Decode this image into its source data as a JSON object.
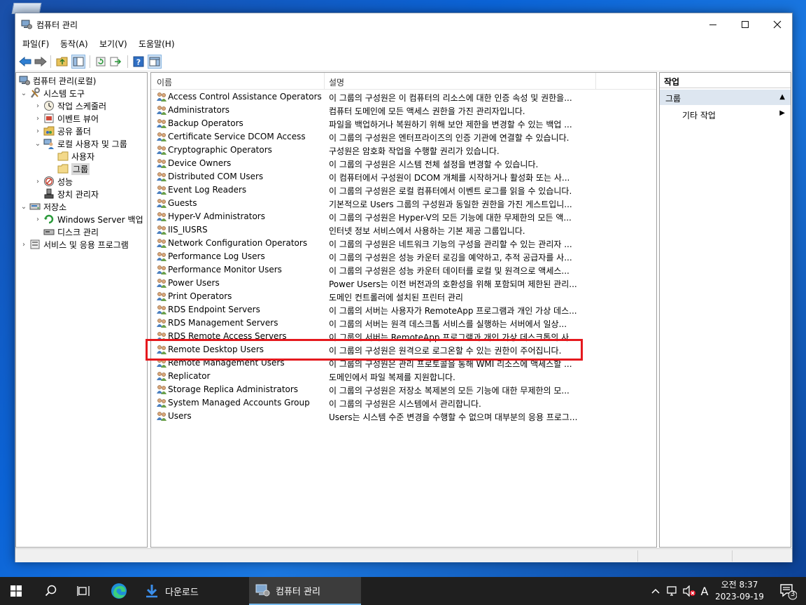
{
  "window": {
    "title": "컴퓨터 관리"
  },
  "menu": [
    "파일(F)",
    "동작(A)",
    "보기(V)",
    "도움말(H)"
  ],
  "tree": [
    {
      "label": "컴퓨터 관리(로컬)",
      "icon": "computer-management-icon"
    },
    {
      "label": "시스템 도구",
      "icon": "system-tools-icon"
    },
    {
      "label": "작업 스케줄러",
      "icon": "task-scheduler-icon"
    },
    {
      "label": "이벤트 뷰어",
      "icon": "event-viewer-icon"
    },
    {
      "label": "공유 폴더",
      "icon": "shared-folders-icon"
    },
    {
      "label": "로컬 사용자 및 그룹",
      "icon": "local-users-groups-icon"
    },
    {
      "label": "사용자",
      "icon": "folder-icon"
    },
    {
      "label": "그룹",
      "icon": "folder-icon"
    },
    {
      "label": "성능",
      "icon": "performance-icon"
    },
    {
      "label": "장치 관리자",
      "icon": "device-manager-icon"
    },
    {
      "label": "저장소",
      "icon": "storage-icon"
    },
    {
      "label": "Windows Server 백업",
      "icon": "backup-icon"
    },
    {
      "label": "디스크 관리",
      "icon": "disk-management-icon"
    },
    {
      "label": "서비스 및 응용 프로그램",
      "icon": "services-apps-icon"
    }
  ],
  "list": {
    "columns": [
      "이름",
      "설명"
    ],
    "rows": [
      {
        "name": "Access Control Assistance Operators",
        "description": "이 그룹의 구성원은 이 컴퓨터의 리소스에 대한 인증 속성 및 권한을..."
      },
      {
        "name": "Administrators",
        "description": "컴퓨터 도메인에 모든 액세스 권한을 가진 관리자입니다."
      },
      {
        "name": "Backup Operators",
        "description": "파일을 백업하거나 복원하기 위해 보안 제한을 변경할 수 있는 백업 ..."
      },
      {
        "name": "Certificate Service DCOM Access",
        "description": "이 그룹의 구성원은 엔터프라이즈의 인증 기관에 연결할 수 있습니다."
      },
      {
        "name": "Cryptographic Operators",
        "description": "구성원은 암호화 작업을 수행할 권리가 있습니다."
      },
      {
        "name": "Device Owners",
        "description": "이 그룹의 구성원은 시스템 전체 설정을 변경할 수 있습니다."
      },
      {
        "name": "Distributed COM Users",
        "description": "이 컴퓨터에서 구성원이 DCOM 개체를 시작하거나 활성화 또는 사..."
      },
      {
        "name": "Event Log Readers",
        "description": "이 그룹의 구성원은 로컬 컴퓨터에서 이벤트 로그를 읽을 수 있습니다."
      },
      {
        "name": "Guests",
        "description": "기본적으로 Users 그룹의 구성원과 동일한 권한을 가진 게스트입니..."
      },
      {
        "name": "Hyper-V Administrators",
        "description": "이 그룹의 구성원은 Hyper-V의 모든 기능에 대한 무제한의 모든 액..."
      },
      {
        "name": "IIS_IUSRS",
        "description": "인터넷 정보 서비스에서 사용하는 기본 제공 그룹입니다."
      },
      {
        "name": "Network Configuration Operators",
        "description": "이 그룹의 구성원은 네트워크 기능의 구성을 관리할 수 있는 관리자 ..."
      },
      {
        "name": "Performance Log Users",
        "description": "이 그룹의 구성원은 성능 카운터 로깅을 예약하고, 추적 공급자를 사..."
      },
      {
        "name": "Performance Monitor Users",
        "description": "이 그룹의 구성원은 성능 카운터 데이터를 로컬 및 원격으로 액세스..."
      },
      {
        "name": "Power Users",
        "description": "Power Users는 이전 버전과의 호환성을 위해 포함되며 제한된 관리..."
      },
      {
        "name": "Print Operators",
        "description": "도메인 컨트롤러에 설치된 프린터 관리"
      },
      {
        "name": "RDS Endpoint Servers",
        "description": "이 그룹의 서버는 사용자가 RemoteApp 프로그램과 개인 가상 데스..."
      },
      {
        "name": "RDS Management Servers",
        "description": "이 그룹의 서버는 원격 데스크톱 서비스를 실행하는 서버에서 일상..."
      },
      {
        "name": "RDS Remote Access Servers",
        "description": "이 그룹의 서버는 RemoteApp 프로그램과 개인 가상 데스크톱의 사..."
      },
      {
        "name": "Remote Desktop Users",
        "description": "이 그룹의 구성원은 원격으로 로그온할 수 있는 권한이 주어집니다."
      },
      {
        "name": "Remote Management Users",
        "description": "이 그룹의 구성원은 관리 프로토콜을 통해 WMI 리소스에 액세스할 ..."
      },
      {
        "name": "Replicator",
        "description": "도메인에서 파일 복제를 지원합니다."
      },
      {
        "name": "Storage Replica Administrators",
        "description": "이 그룹의 구성원은 저장소 복제본의 모든 기능에 대한 무제한의 모..."
      },
      {
        "name": "System Managed Accounts Group",
        "description": "이 그룹의 구성원은 시스템에서 관리합니다."
      },
      {
        "name": "Users",
        "description": "Users는 시스템 수준 변경을 수행할 수 없으며 대부분의 응용 프로그..."
      }
    ]
  },
  "actions": {
    "header": "작업",
    "group": "그룹",
    "item": "기타 작업"
  },
  "taskbar": {
    "apps": [
      {
        "label": "다운로드",
        "icon": "download-icon"
      },
      {
        "label": "컴퓨터 관리",
        "icon": "computer-management-icon"
      }
    ],
    "ime": "A",
    "time": "오전 8:37",
    "date": "2023-09-19",
    "notification_count": "3"
  },
  "colors": {
    "highlight_border": "#e5191e",
    "action_group_bg": "#dde6f0",
    "taskbar_bg": "#1f1f1f"
  }
}
